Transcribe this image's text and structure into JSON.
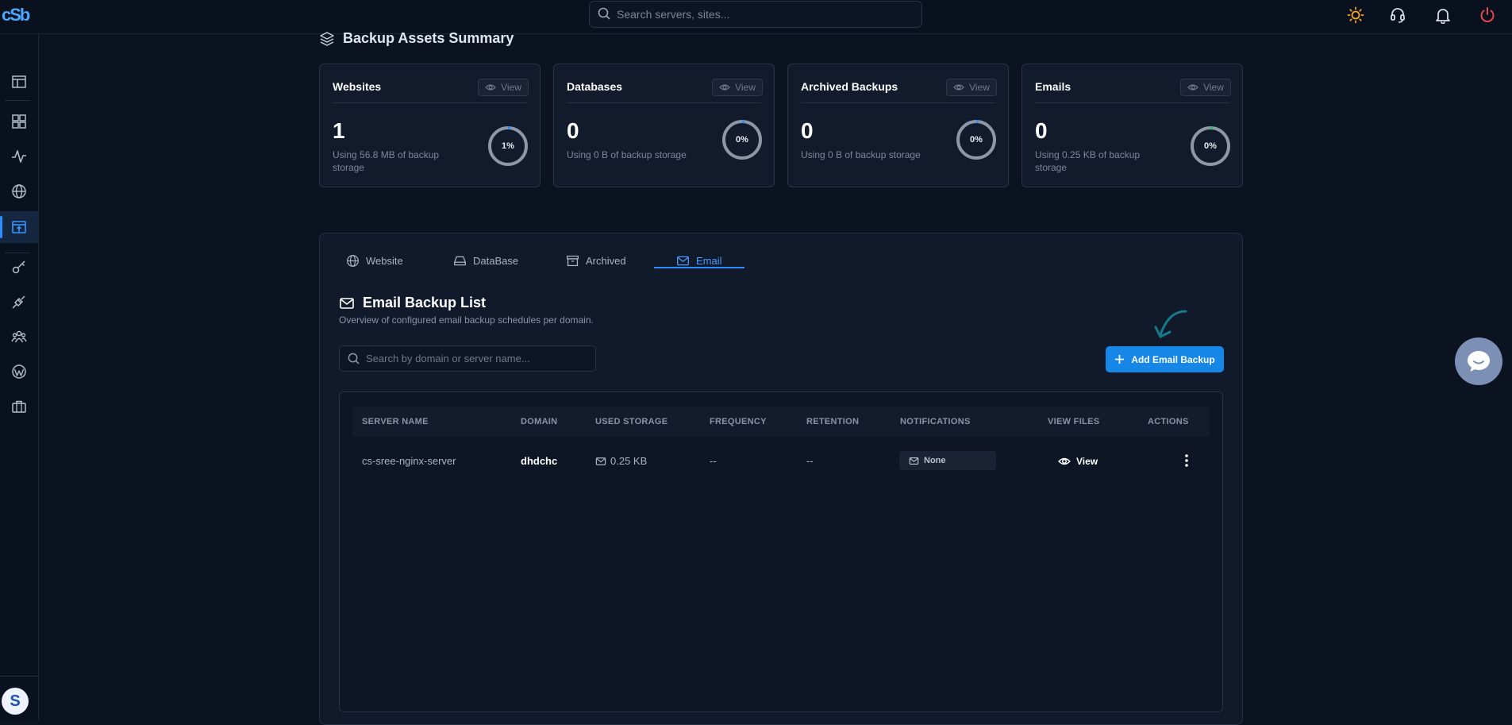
{
  "header": {
    "logo_text": "cSb",
    "search_placeholder": "Search servers, sites...",
    "icons": [
      "sun-icon",
      "headset-icon",
      "bell-icon",
      "power-icon"
    ],
    "colors": {
      "sun": "#f5a623",
      "power": "#e5484d",
      "accent": "#2d8cff"
    }
  },
  "sidebar": {
    "items": [
      "layout-icon",
      "dashboard-icon",
      "activity-icon",
      "globe-icon",
      "backup-icon",
      "key-icon",
      "plug-icon",
      "users-icon",
      "wordpress-icon",
      "briefcase-icon"
    ],
    "active": "backup-icon",
    "avatar_initial": "S"
  },
  "summary": {
    "title": "Backup Assets Summary",
    "cards": [
      {
        "title": "Websites",
        "view": "View",
        "count": "1",
        "desc": "Using 56.8 MB of backup storage",
        "percent_label": "1%",
        "percent": 1
      },
      {
        "title": "Databases",
        "view": "View",
        "count": "0",
        "desc": "Using 0 B of backup storage",
        "percent_label": "0%",
        "percent": 0
      },
      {
        "title": "Archived Backups",
        "view": "View",
        "count": "0",
        "desc": "Using 0 B of backup storage",
        "percent_label": "0%",
        "percent": 0
      },
      {
        "title": "Emails",
        "view": "View",
        "count": "0",
        "desc": "Using 0.25 KB of backup storage",
        "percent_label": "0%",
        "percent": 0
      }
    ]
  },
  "tabs": [
    {
      "label": "Website",
      "icon": "globe-icon"
    },
    {
      "label": "DataBase",
      "icon": "drive-icon"
    },
    {
      "label": "Archived",
      "icon": "archive-icon"
    },
    {
      "label": "Email",
      "icon": "mail-icon",
      "active": true
    }
  ],
  "list": {
    "title": "Email Backup List",
    "subtitle": "Overview of configured email backup schedules per domain.",
    "search_placeholder": "Search by domain or server name...",
    "add_label": "Add Email Backup"
  },
  "table": {
    "headers": [
      "SERVER NAME",
      "DOMAIN",
      "USED STORAGE",
      "FREQUENCY",
      "RETENTION",
      "NOTIFICATIONS",
      "VIEW FILES",
      "ACTIONS"
    ],
    "rows": [
      {
        "server": "cs-sree-nginx-server",
        "domain": "dhdchc",
        "storage": "0.25 KB",
        "frequency": "--",
        "retention": "--",
        "notifications": "None",
        "view": "View"
      }
    ]
  }
}
